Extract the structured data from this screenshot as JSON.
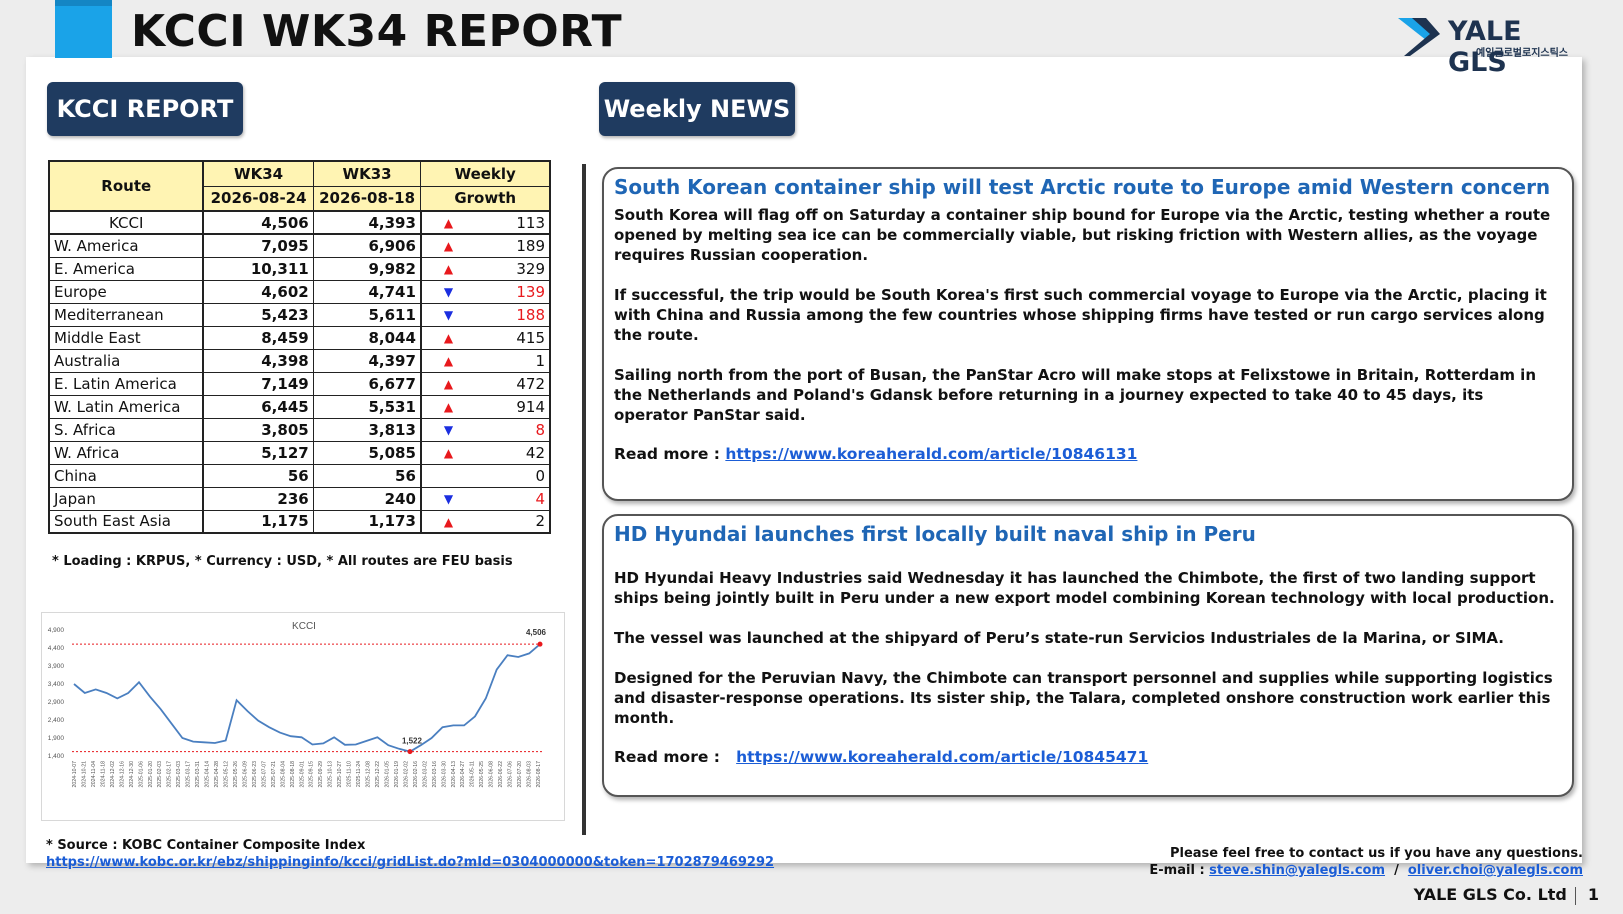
{
  "header": {
    "title": "KCCI WK34 REPORT",
    "logo_name": "YALE GLS",
    "logo_sub": "예일글로벌로지스틱스"
  },
  "sections": {
    "kcci_label": "KCCI REPORT",
    "news_label": "Weekly NEWS"
  },
  "table": {
    "headers": {
      "route": "Route",
      "wk34": "WK34",
      "wk34_date": "2026-08-24",
      "wk33": "WK33",
      "wk33_date": "2026-08-18",
      "growth_top": "Weekly",
      "growth_bot": "Growth"
    },
    "rows": [
      {
        "route": "KCCI",
        "wk34": "4,506",
        "wk33": "4,393",
        "dir": "up",
        "growth": "113"
      },
      {
        "route": "W. America",
        "wk34": "7,095",
        "wk33": "6,906",
        "dir": "up",
        "growth": "189"
      },
      {
        "route": "E. America",
        "wk34": "10,311",
        "wk33": "9,982",
        "dir": "up",
        "growth": "329"
      },
      {
        "route": "Europe",
        "wk34": "4,602",
        "wk33": "4,741",
        "dir": "down",
        "growth": "139"
      },
      {
        "route": "Mediterranean",
        "wk34": "5,423",
        "wk33": "5,611",
        "dir": "down",
        "growth": "188"
      },
      {
        "route": "Middle East",
        "wk34": "8,459",
        "wk33": "8,044",
        "dir": "up",
        "growth": "415"
      },
      {
        "route": "Australia",
        "wk34": "4,398",
        "wk33": "4,397",
        "dir": "up",
        "growth": "1"
      },
      {
        "route": "E. Latin America",
        "wk34": "7,149",
        "wk33": "6,677",
        "dir": "up",
        "growth": "472"
      },
      {
        "route": "W. Latin America",
        "wk34": "6,445",
        "wk33": "5,531",
        "dir": "up",
        "growth": "914"
      },
      {
        "route": "S. Africa",
        "wk34": "3,805",
        "wk33": "3,813",
        "dir": "down",
        "growth": "8"
      },
      {
        "route": "W. Africa",
        "wk34": "5,127",
        "wk33": "5,085",
        "dir": "up",
        "growth": "42"
      },
      {
        "route": "China",
        "wk34": "56",
        "wk33": "56",
        "dir": "none",
        "growth": "0"
      },
      {
        "route": "Japan",
        "wk34": "236",
        "wk33": "240",
        "dir": "down",
        "growth": "4"
      },
      {
        "route": "South East Asia",
        "wk34": "1,175",
        "wk33": "1,173",
        "dir": "up",
        "growth": "2"
      }
    ],
    "up_arrow": "▲",
    "down_arrow": "▼"
  },
  "note": "* Loading :  KRPUS, * Currency : USD, * All routes are FEU basis",
  "chart_data": {
    "type": "line",
    "title": "KCCI",
    "ylim": [
      1400,
      4900
    ],
    "yticks": [
      "1,400",
      "1,900",
      "2,400",
      "2,900",
      "3,400",
      "3,900",
      "4,400",
      "4,900"
    ],
    "ytick_values": [
      1400,
      1900,
      2400,
      2900,
      3400,
      3900,
      4400,
      4900
    ],
    "x": [
      "2024-10-07",
      "2024-10-21",
      "2024-11-04",
      "2024-11-18",
      "2024-12-02",
      "2024-12-16",
      "2024-12-30",
      "2025-01-06",
      "2025-01-20",
      "2025-02-03",
      "2025-02-17",
      "2025-03-03",
      "2025-03-17",
      "2025-03-31",
      "2025-04-14",
      "2025-04-28",
      "2025-05-12",
      "2025-05-26",
      "2025-06-09",
      "2025-06-23",
      "2025-07-07",
      "2025-07-21",
      "2025-08-04",
      "2025-08-18",
      "2025-09-01",
      "2025-09-15",
      "2025-09-29",
      "2025-10-13",
      "2025-10-27",
      "2025-11-10",
      "2025-11-24",
      "2025-12-08",
      "2025-12-22",
      "2026-01-05",
      "2026-01-19",
      "2026-02-02",
      "2026-02-16",
      "2026-03-02",
      "2026-03-16",
      "2026-03-30",
      "2026-04-13",
      "2026-04-27",
      "2026-05-11",
      "2026-05-25",
      "2026-06-08",
      "2026-06-22",
      "2026-07-06",
      "2026-07-20",
      "2026-08-03",
      "2026-08-17",
      "2026-08-24"
    ],
    "xticks": [
      "2024-10-07",
      "2024-10-21",
      "2024-11-04",
      "2024-11-18",
      "2024-12-02",
      "2024-12-16",
      "2024-12-30",
      "2025-01-06",
      "2025-01-20",
      "2025-02-03",
      "2025-02-17",
      "2025-03-03",
      "2025-03-17",
      "2025-03-31",
      "2025-04-14",
      "2025-04-28",
      "2025-05-12",
      "2025-05-26",
      "2025-06-09",
      "2025-06-23",
      "2025-07-07",
      "2025-07-21",
      "2025-08-04",
      "2025-08-18",
      "2025-09-01",
      "2025-09-15",
      "2025-09-29",
      "2025-10-13",
      "2025-10-27",
      "2025-11-10",
      "2025-11-24",
      "2025-12-08",
      "2025-12-22",
      "2026-01-05",
      "2026-01-19",
      "2026-02-02",
      "2026-02-16",
      "2026-03-02",
      "2026-03-16",
      "2026-03-30",
      "2026-04-13",
      "2026-04-27",
      "2026-05-11",
      "2026-05-25",
      "2026-06-08",
      "2026-06-22",
      "2026-07-06",
      "2026-07-20",
      "2026-08-03",
      "2026-08-17"
    ],
    "values": [
      3400,
      3150,
      3250,
      3150,
      3000,
      3150,
      3450,
      3050,
      2700,
      2300,
      1900,
      1800,
      1780,
      1760,
      1830,
      2950,
      2650,
      2380,
      2200,
      2050,
      1950,
      1920,
      1720,
      1750,
      1920,
      1710,
      1720,
      1820,
      1920,
      1700,
      1600,
      1522,
      1700,
      1900,
      2200,
      2250,
      2250,
      2500,
      3000,
      3800,
      4200,
      4150,
      4250,
      4506
    ],
    "max_label": "4,506",
    "min_label": "1,522",
    "max_value": 4506,
    "min_value": 1522,
    "grid": false,
    "colors": {
      "line": "#4a7fc0",
      "ref": "#e8191d"
    }
  },
  "source": {
    "label": "* Source : KOBC Container Composite Index",
    "link": "https://www.kobc.or.kr/ebz/shippinginfo/kcci/gridList.do?mId=0304000000&token=1702879469292"
  },
  "news": [
    {
      "title": "South Korean container ship will test Arctic route to Europe amid Western concern",
      "paragraphs": [
        "South Korea will flag off on Saturday a container ship bound for Europe via the Arctic, testing whether a route opened by melting sea ice can be commercially viable, but risking friction with Western allies, as the voyage requires Russian cooperation.",
        "If successful, the trip would be South Korea's first such commercial voyage to Europe via the Arctic, placing it with China and Russia among the few countries whose shipping firms have tested or run cargo services along the route.",
        "Sailing north from the port of Busan, the PanStar Acro will make stops at Felixstowe in Britain, Rotterdam in the Netherlands and Poland's Gdansk before returning in a journey expected to take 40 to 45 days, its operator PanStar said."
      ],
      "read_more_label": "Read more : ",
      "link": "https://www.koreaherald.com/article/10846131"
    },
    {
      "title": "HD Hyundai launches first locally built naval ship in Peru",
      "paragraphs": [
        "HD Hyundai Heavy Industries said Wednesday it has launched the Chimbote, the first of two landing support ships being jointly built in Peru under a new export model combining Korean technology with local production.",
        "The vessel was launched at the shipyard of Peru’s state-run Servicios Industriales de la Marina, or SIMA.",
        "Designed for the Peruvian Navy, the Chimbote can transport personnel and supplies while supporting logistics and disaster-response operations. Its sister ship, the Talara, completed onshore construction work earlier this month."
      ],
      "read_more_label": "Read more :   ",
      "link": "https://www.koreaherald.com/article/10845471"
    }
  ],
  "contact": {
    "line1": "Please feel free to contact us if you have any questions.",
    "email_label": "E-mail : ",
    "email1": "steve.shin@yalegls.com",
    "sep": "  /  ",
    "email2": "oliver.choi@yalegls.com"
  },
  "footer": {
    "company": "YALE GLS Co. Ltd",
    "page": "1"
  }
}
